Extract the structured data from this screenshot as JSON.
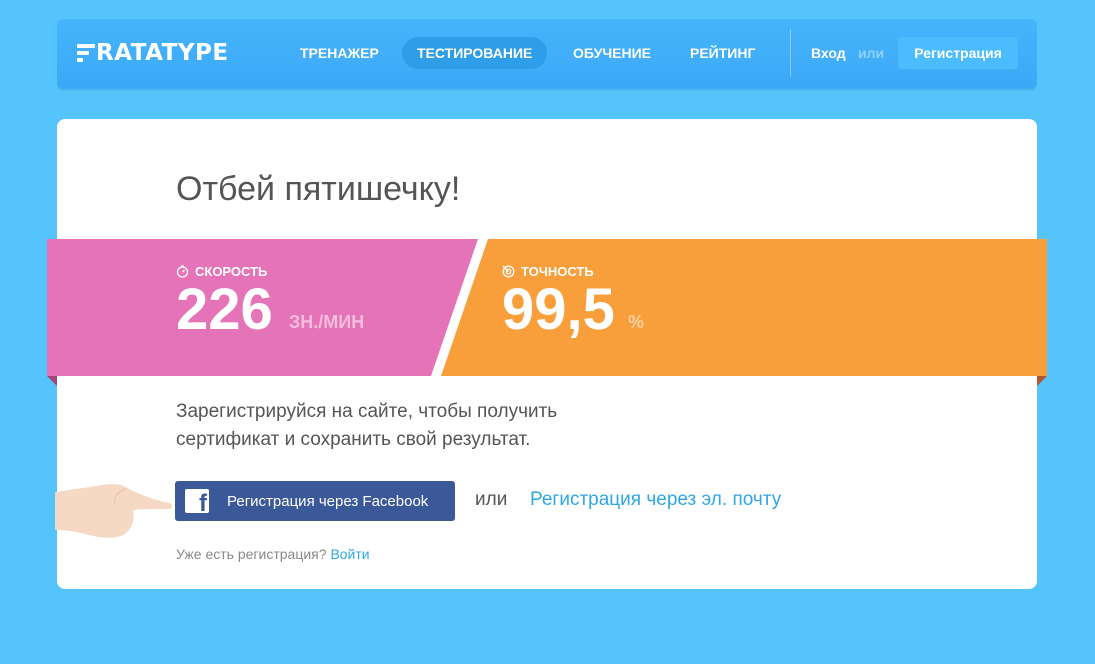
{
  "header": {
    "logo_text": "RATATYPE",
    "nav": [
      {
        "label": "Тренажер",
        "active": false
      },
      {
        "label": "Тестирование",
        "active": true
      },
      {
        "label": "Обучение",
        "active": false
      },
      {
        "label": "Рейтинг",
        "active": false
      }
    ],
    "login": "Вход",
    "or": "или",
    "register": "Регистрация"
  },
  "result": {
    "title": "Отбей пятишечку!",
    "speed": {
      "label": "Скорость",
      "value": "226",
      "unit": "ЗН./МИН",
      "color": "#e573b7",
      "icon": "stopwatch-icon"
    },
    "accuracy": {
      "label": "Точность",
      "value": "99,5",
      "unit": "%",
      "color": "#f89f3b",
      "icon": "target-icon"
    }
  },
  "signup": {
    "description_line1": "Зарегистрируйся на сайте, чтобы получить",
    "description_line2": "сертификат и сохранить свой результат.",
    "facebook_button": "Регистрация через Facebook",
    "or": "или",
    "email_link": "Регистрация через эл. почту",
    "already_text": "Уже есть регистрация?",
    "signin_link": "Войти"
  },
  "colors": {
    "background": "#55c4fd",
    "header": "#3aa8f6",
    "facebook": "#3b5998",
    "link": "#2fa7e3"
  }
}
